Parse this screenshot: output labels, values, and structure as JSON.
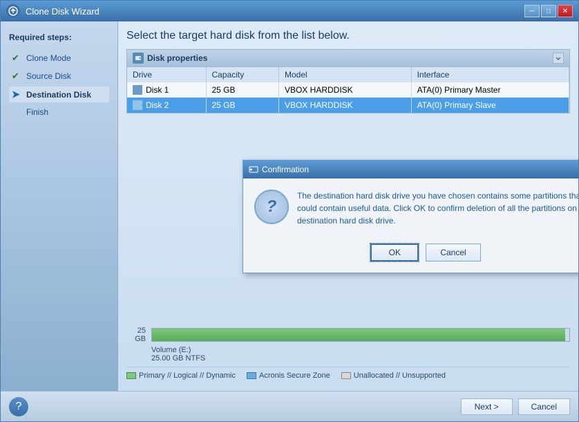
{
  "window": {
    "title": "Clone Disk Wizard",
    "min_btn": "─",
    "max_btn": "□",
    "close_btn": "✕"
  },
  "sidebar": {
    "title": "Required steps:",
    "items": [
      {
        "id": "clone-mode",
        "label": "Clone Mode",
        "state": "done"
      },
      {
        "id": "source-disk",
        "label": "Source Disk",
        "state": "done"
      },
      {
        "id": "destination-disk",
        "label": "Destination Disk",
        "state": "active"
      },
      {
        "id": "finish",
        "label": "Finish",
        "state": "none"
      }
    ]
  },
  "panel": {
    "heading": "Select the target hard disk from the list below.",
    "disk_properties": {
      "title": "Disk properties",
      "columns": [
        "Drive",
        "Capacity",
        "Model",
        "Interface"
      ],
      "rows": [
        {
          "drive": "Disk 1",
          "capacity": "25 GB",
          "model": "VBOX HARDDISK",
          "interface": "ATA(0) Primary Master",
          "selected": false
        },
        {
          "drive": "Disk 2",
          "capacity": "25 GB",
          "model": "VBOX HARDDISK",
          "interface": "ATA(0) Primary Slave",
          "selected": true
        }
      ]
    }
  },
  "disk_viz": {
    "size_label": "25 GB",
    "bar_fill_pct": 99,
    "volume_label": "Volume (E:)",
    "volume_info": "25.00 GB  NTFS"
  },
  "legend": {
    "items": [
      {
        "color": "#7ec87e",
        "label": "Primary // Logical // Dynamic"
      },
      {
        "color": "#6aacdc",
        "label": "Acronis Secure Zone"
      },
      {
        "color": "#d0d0d0",
        "label": "Unallocated // Unsupported"
      }
    ]
  },
  "dialog": {
    "title": "Confirmation",
    "message": "The destination hard disk drive you have chosen contains some partitions that could contain useful data. Click OK to confirm deletion of all the partitions on the destination hard disk drive.",
    "ok_label": "OK",
    "cancel_label": "Cancel"
  },
  "bottom": {
    "next_label": "Next >",
    "cancel_label": "Cancel"
  }
}
